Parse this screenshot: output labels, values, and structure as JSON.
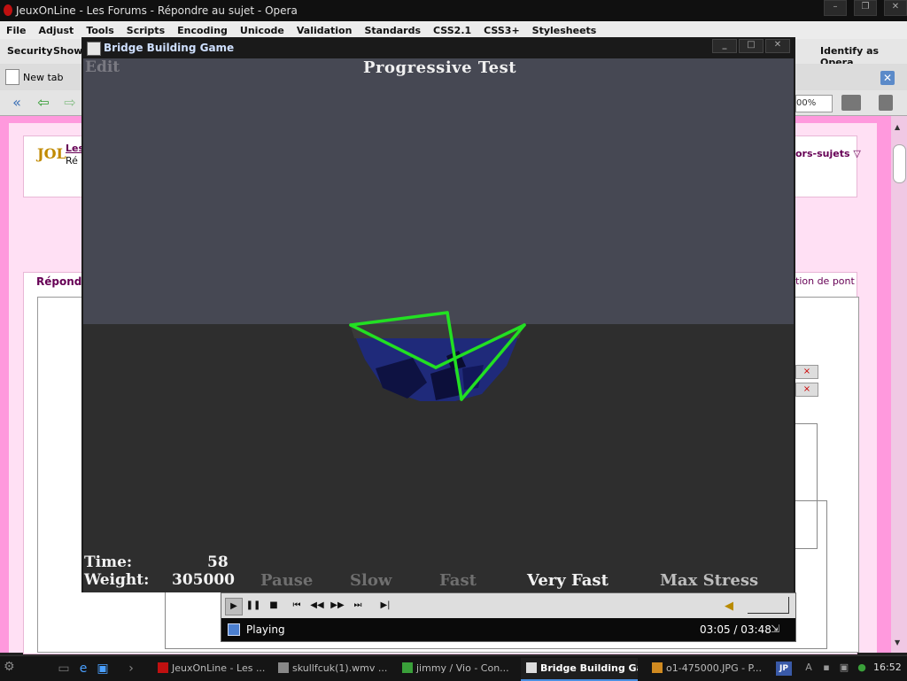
{
  "browser": {
    "title": "JeuxOnLine - Les Forums - Répondre au sujet - Opera",
    "menu": [
      "File",
      "Adjust",
      "Tools",
      "Scripts",
      "Encoding",
      "Unicode",
      "Validation",
      "Standards",
      "CSS2.1",
      "CSS3+",
      "Stylesheets"
    ],
    "toolbar": {
      "security": "Security",
      "show": "Show",
      "identify": "Identify as Opera"
    },
    "new_tab": "New tab",
    "zoom": "00%"
  },
  "page": {
    "logo": "JOL",
    "forum_link": "Les",
    "forum_sub": "Ré",
    "hors_sujets": "ors-sujets",
    "repondre": "Répond",
    "tion_de_pont": "tion de pont",
    "close_mark": "×"
  },
  "game": {
    "window_title": "Bridge Building Game",
    "mode_label": "Edit",
    "test_title": "Progressive Test",
    "time_label": "Time:",
    "time_value": "58",
    "weight_label": "Weight:",
    "weight_value": "305000",
    "speeds": [
      "Pause",
      "Slow",
      "Fast",
      "Very Fast",
      "Max Stress"
    ],
    "colors": {
      "beam": "#22e022",
      "water": "#1f2a7a",
      "sky": "#464853",
      "ground": "#2e2e2e"
    }
  },
  "player": {
    "status": "Playing",
    "time": "03:05 / 03:48"
  },
  "taskbar": {
    "items": [
      "JeuxOnLine - Les ...",
      "skullfcuk(1).wmv ...",
      "jimmy / Vio - Con...",
      "Bridge Building Ga...",
      "o1-475000.JPG - P..."
    ],
    "language": "JP",
    "clock": "16:52"
  }
}
